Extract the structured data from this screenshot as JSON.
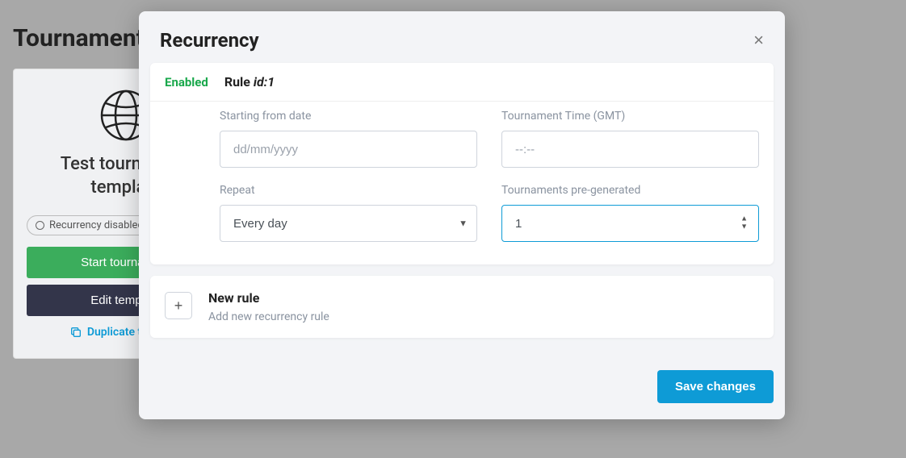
{
  "background": {
    "page_title": "Tournament",
    "template_name_line1": "Test tournament",
    "template_name_line2": "template",
    "recurrency_badge": "Recurrency disabled",
    "start_button": "Start tournament",
    "edit_button": "Edit template",
    "duplicate_link": "Duplicate template"
  },
  "modal": {
    "title": "Recurrency",
    "close_glyph": "×",
    "rule": {
      "enabled_label": "Enabled",
      "title_prefix": "Rule ",
      "title_id": "id:1",
      "fields": {
        "start_date_label": "Starting from date",
        "start_date_placeholder": "dd/mm/yyyy",
        "time_label": "Tournament Time (GMT)",
        "time_placeholder": "--:--",
        "repeat_label": "Repeat",
        "repeat_value": "Every day",
        "pregen_label": "Tournaments pre-generated",
        "pregen_value": "1"
      }
    },
    "new_rule": {
      "plus_glyph": "+",
      "title": "New rule",
      "subtitle": "Add new recurrency rule"
    },
    "save_label": "Save changes"
  }
}
